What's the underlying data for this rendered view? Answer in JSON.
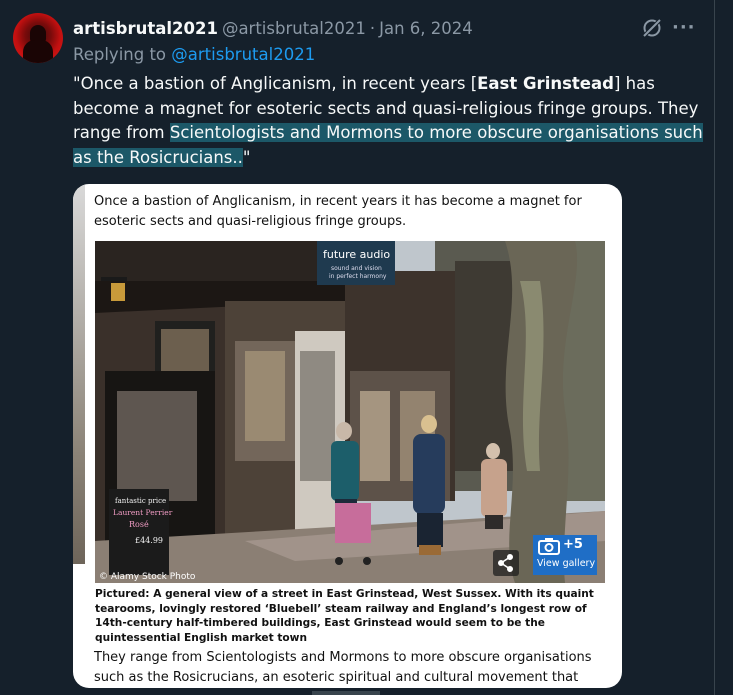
{
  "tweet": {
    "display_name": "artisbrutal2021",
    "handle": "@artisbrutal2021",
    "separator": "·",
    "date": "Jan 6, 2024",
    "replying_to_label": "Replying to",
    "replying_to_handle": "@artisbrutal2021",
    "text_part1": "\"Once a bastion of Anglicanism, in recent years [",
    "text_bold": "East Grinstead",
    "text_part2": "] has become a magnet for esoteric sects and quasi-religious fringe groups. They range from ",
    "text_highlight": "Scientologists and Mormons to more obscure organisations such as the Rosicrucians..",
    "text_part3": "\"",
    "more_icon": "···"
  },
  "card": {
    "intro_text": "Once a bastion of Anglicanism, in recent years it has become a magnet for esoteric sects and quasi-religious fringe groups.",
    "photo_credit": "© Alamy Stock Photo",
    "sign_text_line1": "future audio",
    "sign_text_line2": "sound and vision",
    "sign_text_line3": "in perfect harmony",
    "board_line1": "fantastic price",
    "board_line2": "Laurent Perrier",
    "board_line3": "Rosé",
    "board_line4": "£44.99",
    "gallery_count": "+5",
    "gallery_label": "View gallery",
    "caption": "Pictured: A general view of a street in East Grinstead, West Sussex. With its quaint tearooms, lovingly restored ‘Bluebell’ steam railway and England’s longest row of 14th-century half-timbered buildings, East Grinstead would seem to be the quintessential English market town",
    "body_text": "They range from Scientologists and Mormons to more obscure organisations such as the Rosicrucians, an esoteric spiritual and cultural movement that dates back to the"
  },
  "colors": {
    "background": "#15202b",
    "text_primary": "#f7f9f9",
    "text_secondary": "#8b98a5",
    "link": "#1d9bf0",
    "highlight": "#1c5868",
    "gallery_button": "#1f6ec6"
  }
}
